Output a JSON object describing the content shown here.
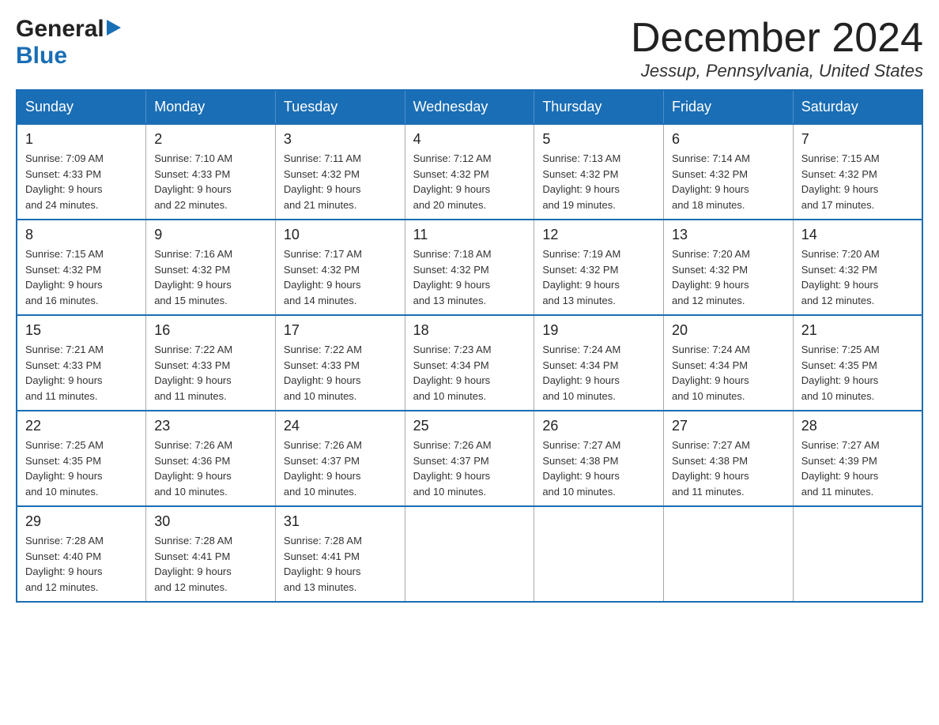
{
  "header": {
    "title": "December 2024",
    "location": "Jessup, Pennsylvania, United States",
    "logo_general": "General",
    "logo_blue": "Blue"
  },
  "weekdays": [
    "Sunday",
    "Monday",
    "Tuesday",
    "Wednesday",
    "Thursday",
    "Friday",
    "Saturday"
  ],
  "weeks": [
    [
      {
        "day": "1",
        "sunrise": "Sunrise: 7:09 AM",
        "sunset": "Sunset: 4:33 PM",
        "daylight": "Daylight: 9 hours",
        "daylight2": "and 24 minutes."
      },
      {
        "day": "2",
        "sunrise": "Sunrise: 7:10 AM",
        "sunset": "Sunset: 4:33 PM",
        "daylight": "Daylight: 9 hours",
        "daylight2": "and 22 minutes."
      },
      {
        "day": "3",
        "sunrise": "Sunrise: 7:11 AM",
        "sunset": "Sunset: 4:32 PM",
        "daylight": "Daylight: 9 hours",
        "daylight2": "and 21 minutes."
      },
      {
        "day": "4",
        "sunrise": "Sunrise: 7:12 AM",
        "sunset": "Sunset: 4:32 PM",
        "daylight": "Daylight: 9 hours",
        "daylight2": "and 20 minutes."
      },
      {
        "day": "5",
        "sunrise": "Sunrise: 7:13 AM",
        "sunset": "Sunset: 4:32 PM",
        "daylight": "Daylight: 9 hours",
        "daylight2": "and 19 minutes."
      },
      {
        "day": "6",
        "sunrise": "Sunrise: 7:14 AM",
        "sunset": "Sunset: 4:32 PM",
        "daylight": "Daylight: 9 hours",
        "daylight2": "and 18 minutes."
      },
      {
        "day": "7",
        "sunrise": "Sunrise: 7:15 AM",
        "sunset": "Sunset: 4:32 PM",
        "daylight": "Daylight: 9 hours",
        "daylight2": "and 17 minutes."
      }
    ],
    [
      {
        "day": "8",
        "sunrise": "Sunrise: 7:15 AM",
        "sunset": "Sunset: 4:32 PM",
        "daylight": "Daylight: 9 hours",
        "daylight2": "and 16 minutes."
      },
      {
        "day": "9",
        "sunrise": "Sunrise: 7:16 AM",
        "sunset": "Sunset: 4:32 PM",
        "daylight": "Daylight: 9 hours",
        "daylight2": "and 15 minutes."
      },
      {
        "day": "10",
        "sunrise": "Sunrise: 7:17 AM",
        "sunset": "Sunset: 4:32 PM",
        "daylight": "Daylight: 9 hours",
        "daylight2": "and 14 minutes."
      },
      {
        "day": "11",
        "sunrise": "Sunrise: 7:18 AM",
        "sunset": "Sunset: 4:32 PM",
        "daylight": "Daylight: 9 hours",
        "daylight2": "and 13 minutes."
      },
      {
        "day": "12",
        "sunrise": "Sunrise: 7:19 AM",
        "sunset": "Sunset: 4:32 PM",
        "daylight": "Daylight: 9 hours",
        "daylight2": "and 13 minutes."
      },
      {
        "day": "13",
        "sunrise": "Sunrise: 7:20 AM",
        "sunset": "Sunset: 4:32 PM",
        "daylight": "Daylight: 9 hours",
        "daylight2": "and 12 minutes."
      },
      {
        "day": "14",
        "sunrise": "Sunrise: 7:20 AM",
        "sunset": "Sunset: 4:32 PM",
        "daylight": "Daylight: 9 hours",
        "daylight2": "and 12 minutes."
      }
    ],
    [
      {
        "day": "15",
        "sunrise": "Sunrise: 7:21 AM",
        "sunset": "Sunset: 4:33 PM",
        "daylight": "Daylight: 9 hours",
        "daylight2": "and 11 minutes."
      },
      {
        "day": "16",
        "sunrise": "Sunrise: 7:22 AM",
        "sunset": "Sunset: 4:33 PM",
        "daylight": "Daylight: 9 hours",
        "daylight2": "and 11 minutes."
      },
      {
        "day": "17",
        "sunrise": "Sunrise: 7:22 AM",
        "sunset": "Sunset: 4:33 PM",
        "daylight": "Daylight: 9 hours",
        "daylight2": "and 10 minutes."
      },
      {
        "day": "18",
        "sunrise": "Sunrise: 7:23 AM",
        "sunset": "Sunset: 4:34 PM",
        "daylight": "Daylight: 9 hours",
        "daylight2": "and 10 minutes."
      },
      {
        "day": "19",
        "sunrise": "Sunrise: 7:24 AM",
        "sunset": "Sunset: 4:34 PM",
        "daylight": "Daylight: 9 hours",
        "daylight2": "and 10 minutes."
      },
      {
        "day": "20",
        "sunrise": "Sunrise: 7:24 AM",
        "sunset": "Sunset: 4:34 PM",
        "daylight": "Daylight: 9 hours",
        "daylight2": "and 10 minutes."
      },
      {
        "day": "21",
        "sunrise": "Sunrise: 7:25 AM",
        "sunset": "Sunset: 4:35 PM",
        "daylight": "Daylight: 9 hours",
        "daylight2": "and 10 minutes."
      }
    ],
    [
      {
        "day": "22",
        "sunrise": "Sunrise: 7:25 AM",
        "sunset": "Sunset: 4:35 PM",
        "daylight": "Daylight: 9 hours",
        "daylight2": "and 10 minutes."
      },
      {
        "day": "23",
        "sunrise": "Sunrise: 7:26 AM",
        "sunset": "Sunset: 4:36 PM",
        "daylight": "Daylight: 9 hours",
        "daylight2": "and 10 minutes."
      },
      {
        "day": "24",
        "sunrise": "Sunrise: 7:26 AM",
        "sunset": "Sunset: 4:37 PM",
        "daylight": "Daylight: 9 hours",
        "daylight2": "and 10 minutes."
      },
      {
        "day": "25",
        "sunrise": "Sunrise: 7:26 AM",
        "sunset": "Sunset: 4:37 PM",
        "daylight": "Daylight: 9 hours",
        "daylight2": "and 10 minutes."
      },
      {
        "day": "26",
        "sunrise": "Sunrise: 7:27 AM",
        "sunset": "Sunset: 4:38 PM",
        "daylight": "Daylight: 9 hours",
        "daylight2": "and 10 minutes."
      },
      {
        "day": "27",
        "sunrise": "Sunrise: 7:27 AM",
        "sunset": "Sunset: 4:38 PM",
        "daylight": "Daylight: 9 hours",
        "daylight2": "and 11 minutes."
      },
      {
        "day": "28",
        "sunrise": "Sunrise: 7:27 AM",
        "sunset": "Sunset: 4:39 PM",
        "daylight": "Daylight: 9 hours",
        "daylight2": "and 11 minutes."
      }
    ],
    [
      {
        "day": "29",
        "sunrise": "Sunrise: 7:28 AM",
        "sunset": "Sunset: 4:40 PM",
        "daylight": "Daylight: 9 hours",
        "daylight2": "and 12 minutes."
      },
      {
        "day": "30",
        "sunrise": "Sunrise: 7:28 AM",
        "sunset": "Sunset: 4:41 PM",
        "daylight": "Daylight: 9 hours",
        "daylight2": "and 12 minutes."
      },
      {
        "day": "31",
        "sunrise": "Sunrise: 7:28 AM",
        "sunset": "Sunset: 4:41 PM",
        "daylight": "Daylight: 9 hours",
        "daylight2": "and 13 minutes."
      },
      {
        "day": "",
        "sunrise": "",
        "sunset": "",
        "daylight": "",
        "daylight2": ""
      },
      {
        "day": "",
        "sunrise": "",
        "sunset": "",
        "daylight": "",
        "daylight2": ""
      },
      {
        "day": "",
        "sunrise": "",
        "sunset": "",
        "daylight": "",
        "daylight2": ""
      },
      {
        "day": "",
        "sunrise": "",
        "sunset": "",
        "daylight": "",
        "daylight2": ""
      }
    ]
  ]
}
